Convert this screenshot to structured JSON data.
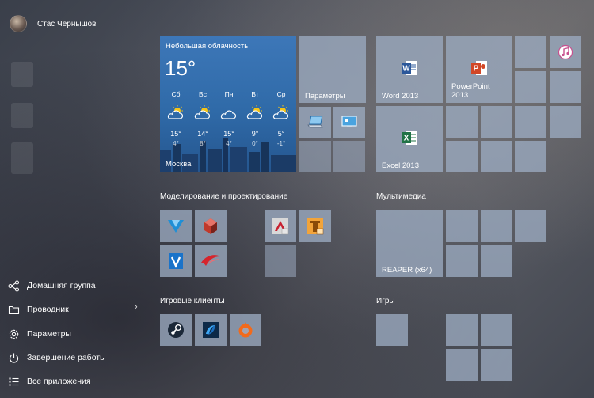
{
  "user": {
    "name": "Стас Чернышов"
  },
  "menu": {
    "homegroup": "Домашняя группа",
    "explorer": "Проводник",
    "settings": "Параметры",
    "shutdown": "Завершение работы",
    "all_apps": "Все приложения"
  },
  "weather": {
    "condition": "Небольшая облачность",
    "temp": "15°",
    "city": "Москва",
    "forecast": [
      {
        "day": "Сб",
        "high": "15°",
        "low": "4°"
      },
      {
        "day": "Вс",
        "high": "14°",
        "low": "8°"
      },
      {
        "day": "Пн",
        "high": "15°",
        "low": "4°"
      },
      {
        "day": "Вт",
        "high": "9°",
        "low": "0°"
      },
      {
        "day": "Ср",
        "high": "5°",
        "low": "-1°"
      }
    ]
  },
  "tiles": {
    "settings": "Параметры",
    "word": "Word 2013",
    "powerpoint": "PowerPoint\n2013",
    "excel": "Excel 2013",
    "reaper": "REAPER (x64)"
  },
  "groups": {
    "modeling": "Моделирование и проектирование",
    "multimedia": "Мультимедиа",
    "game_clients": "Игровые клиенты",
    "games": "Игры"
  },
  "colors": {
    "word": "#2b579a",
    "powerpoint": "#d24726",
    "excel": "#217346",
    "tile": "#9baac0",
    "weather": "#2f6aa8"
  }
}
